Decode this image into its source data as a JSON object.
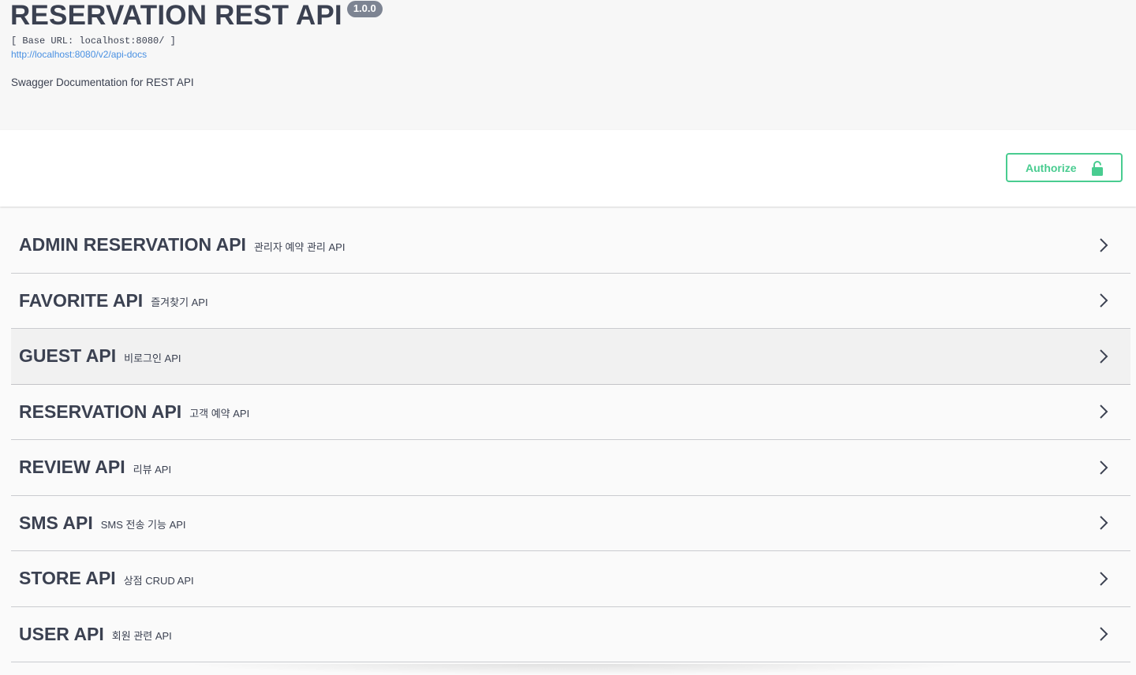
{
  "info": {
    "title": "RESERVATION REST API",
    "version": "1.0.0",
    "base_url": "[ Base URL: localhost:8080/ ]",
    "docs_link": "http://localhost:8080/v2/api-docs",
    "description": "Swagger Documentation for REST API"
  },
  "auth": {
    "label": "Authorize",
    "icon": "lock-icon",
    "color": "#49cc90"
  },
  "tags": [
    {
      "name": "ADMIN RESERVATION API",
      "description": "관리자 예약 관리 API"
    },
    {
      "name": "FAVORITE API",
      "description": "즐겨찾기 API"
    },
    {
      "name": "GUEST API",
      "description": "비로그인 API"
    },
    {
      "name": "RESERVATION API",
      "description": "고객 예약 API"
    },
    {
      "name": "REVIEW API",
      "description": "리뷰 API"
    },
    {
      "name": "SMS API",
      "description": "SMS 전송 기능 API"
    },
    {
      "name": "STORE API",
      "description": "상점 CRUD API"
    },
    {
      "name": "USER API",
      "description": "회원 관련 API"
    }
  ],
  "colors": {
    "text": "#3b4151",
    "link": "#4990e2",
    "version_badge": "#7d8492"
  }
}
